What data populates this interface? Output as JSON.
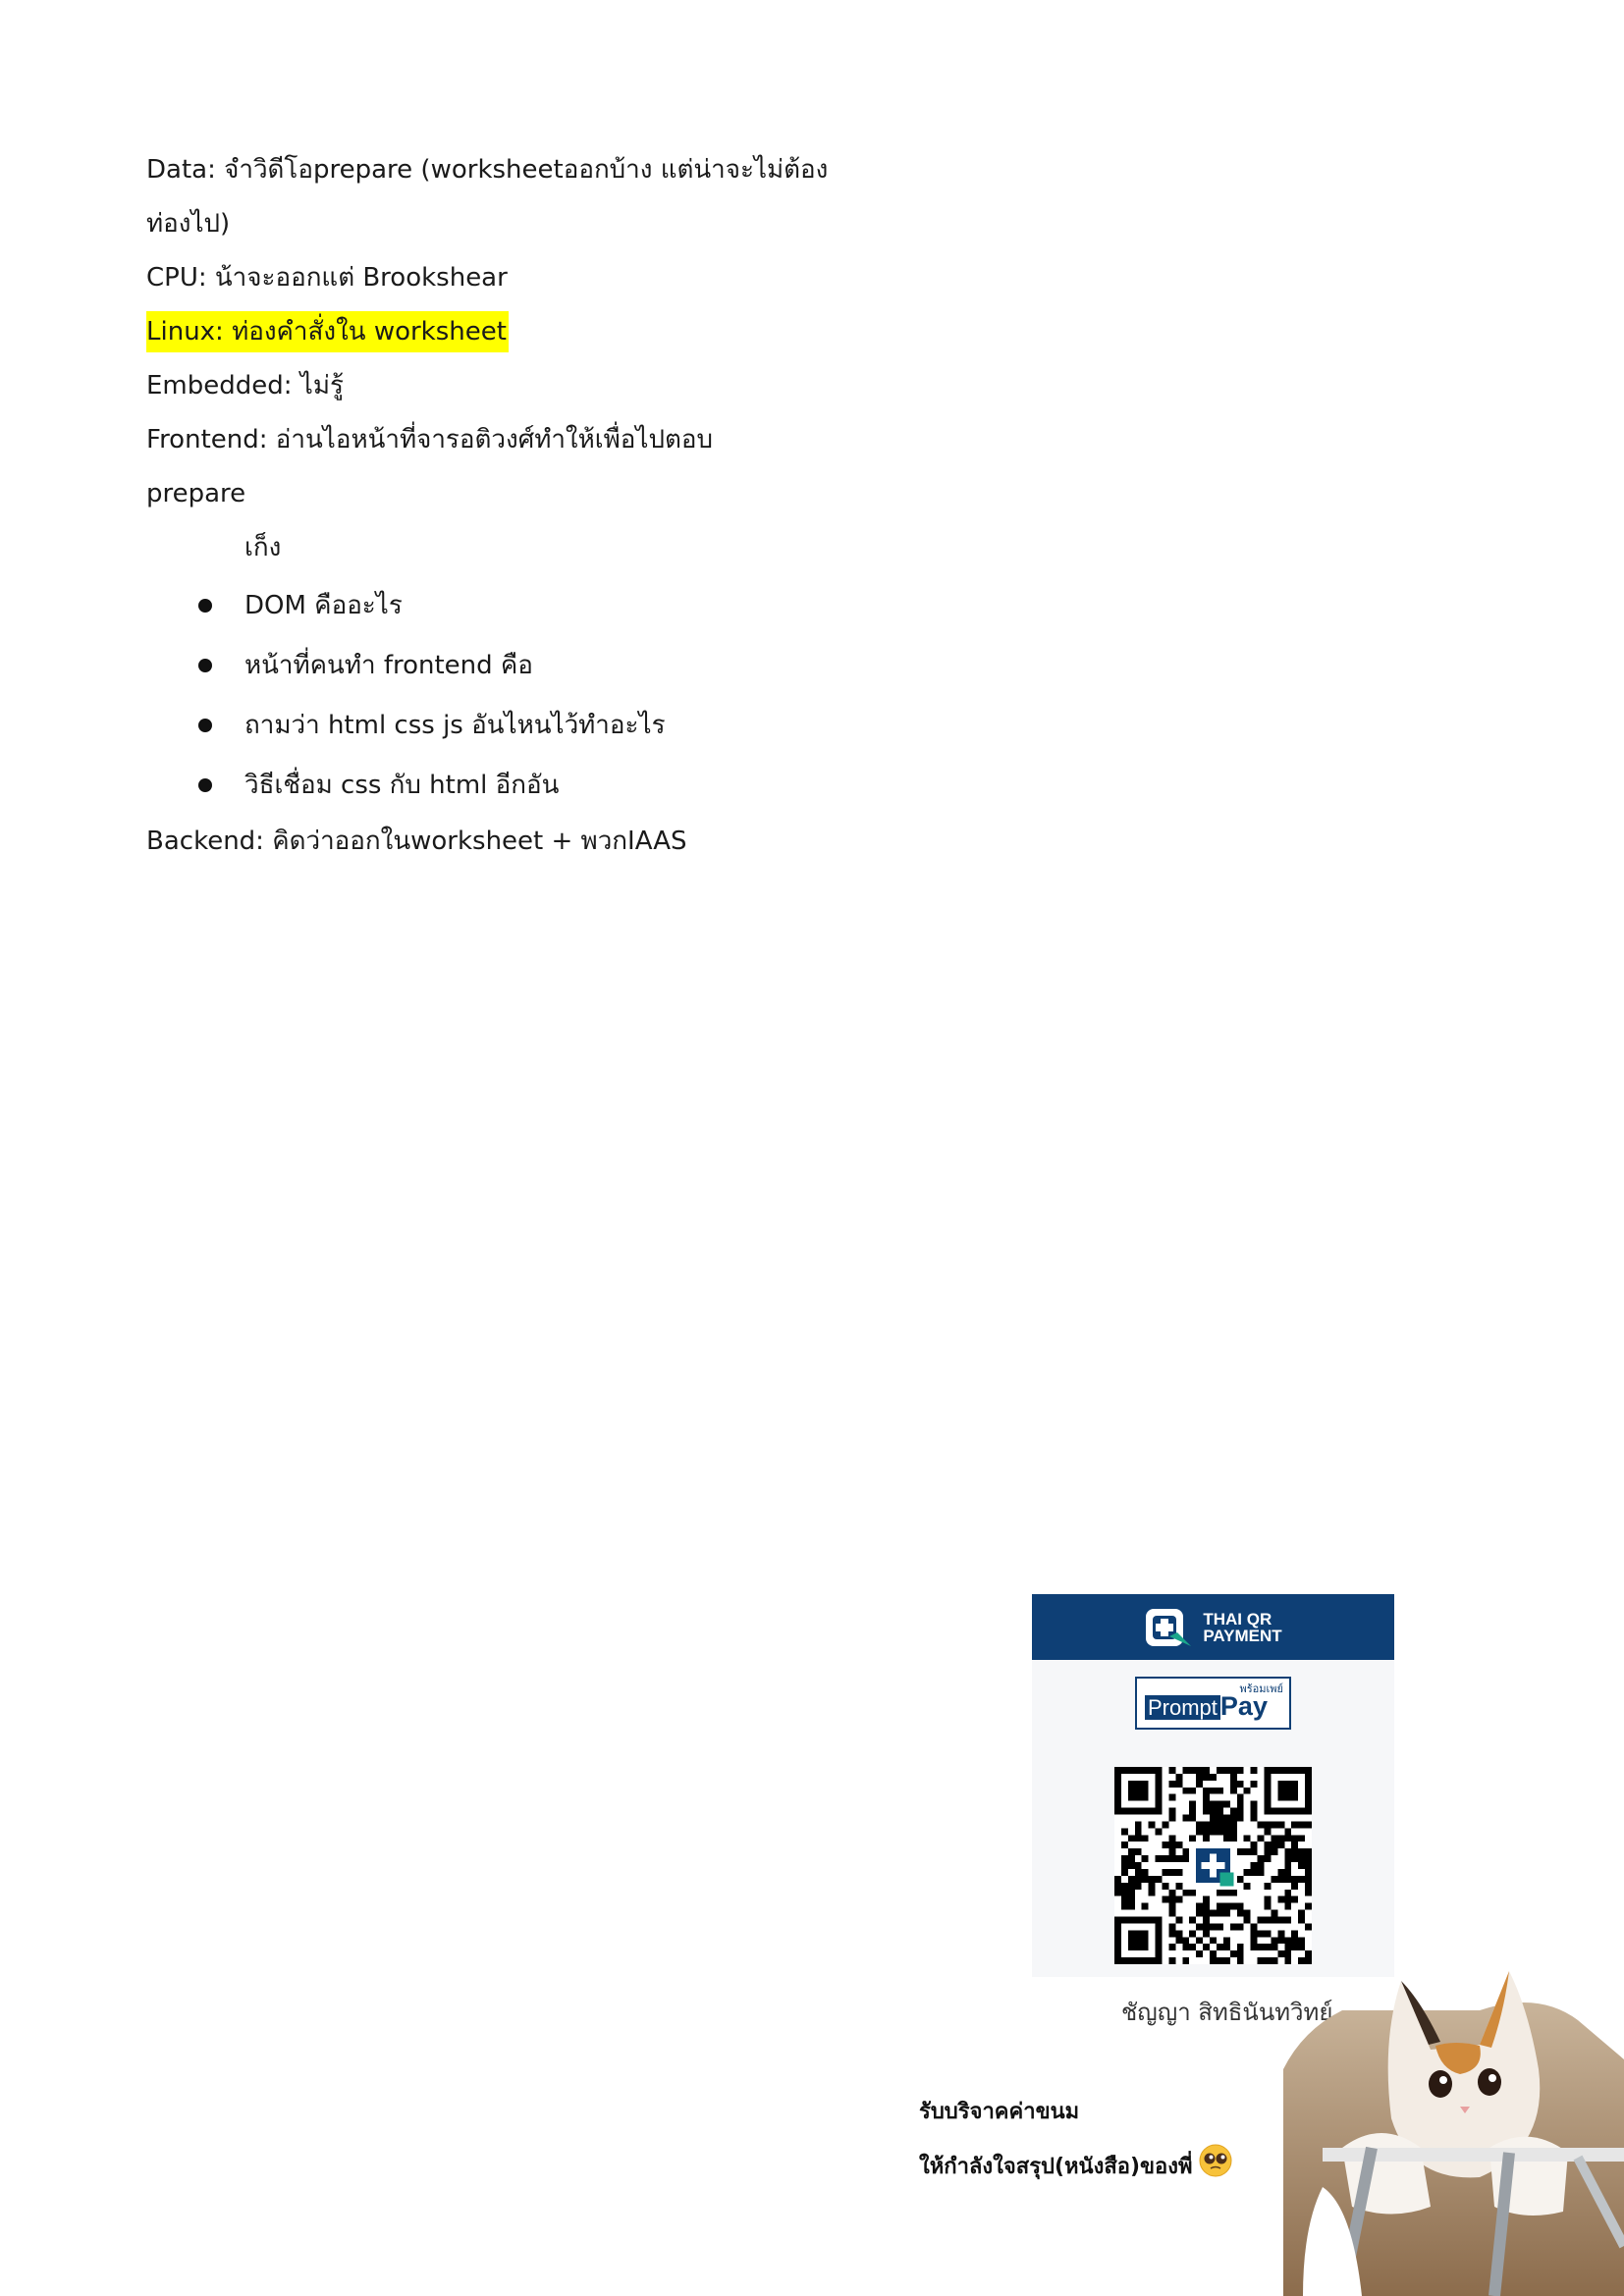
{
  "notes": {
    "data_line_1": "Data: จำวิดีโอprepare (worksheetออกบ้าง แต่น่าจะไม่ต้อง",
    "data_line_2": "ท่องไป)",
    "cpu": "CPU: น้าจะออกแต่ Brookshear",
    "linux": "Linux: ท่องคำสั่งใน worksheet",
    "embedded": "Embedded: ไม่รู้",
    "frontend_line_1": "Frontend: อ่านไอหน้าที่จารอติวงศ์ทำให้เพื่อไปตอบ",
    "frontend_line_2": "prepare",
    "guess_heading": "เก็ง",
    "bullets": [
      "DOM คืออะไร",
      "หน้าที่คนทำ frontend คือ",
      "ถามว่า html css js อันไหนไว้ทำอะไร",
      "วิธีเชื่อม css กับ html อีกอัน"
    ],
    "backend": "Backend: คิดว่าออกในworksheet + พวกIAAS"
  },
  "qr_card": {
    "header_line_1": "THAI QR",
    "header_line_2": "PAYMENT",
    "promptpay_thai": "พร้อมเพย์",
    "promptpay_prompt": "Prompt",
    "promptpay_pay": "Pay",
    "header_color": "#0e3f75",
    "icons": [
      "thai-qr-logo-icon",
      "qr-code-icon"
    ]
  },
  "owner_name": "ชัญญา สิทธินันทวิทย์",
  "donation": {
    "line_1": "รับบริจาคค่าขนม",
    "line_2": "ให้กำลังใจสรุป(หนังสือ)ของพี่",
    "emoji_icon": "pleading-face-emoji-icon"
  },
  "cat_image": "cat-photo-icon"
}
